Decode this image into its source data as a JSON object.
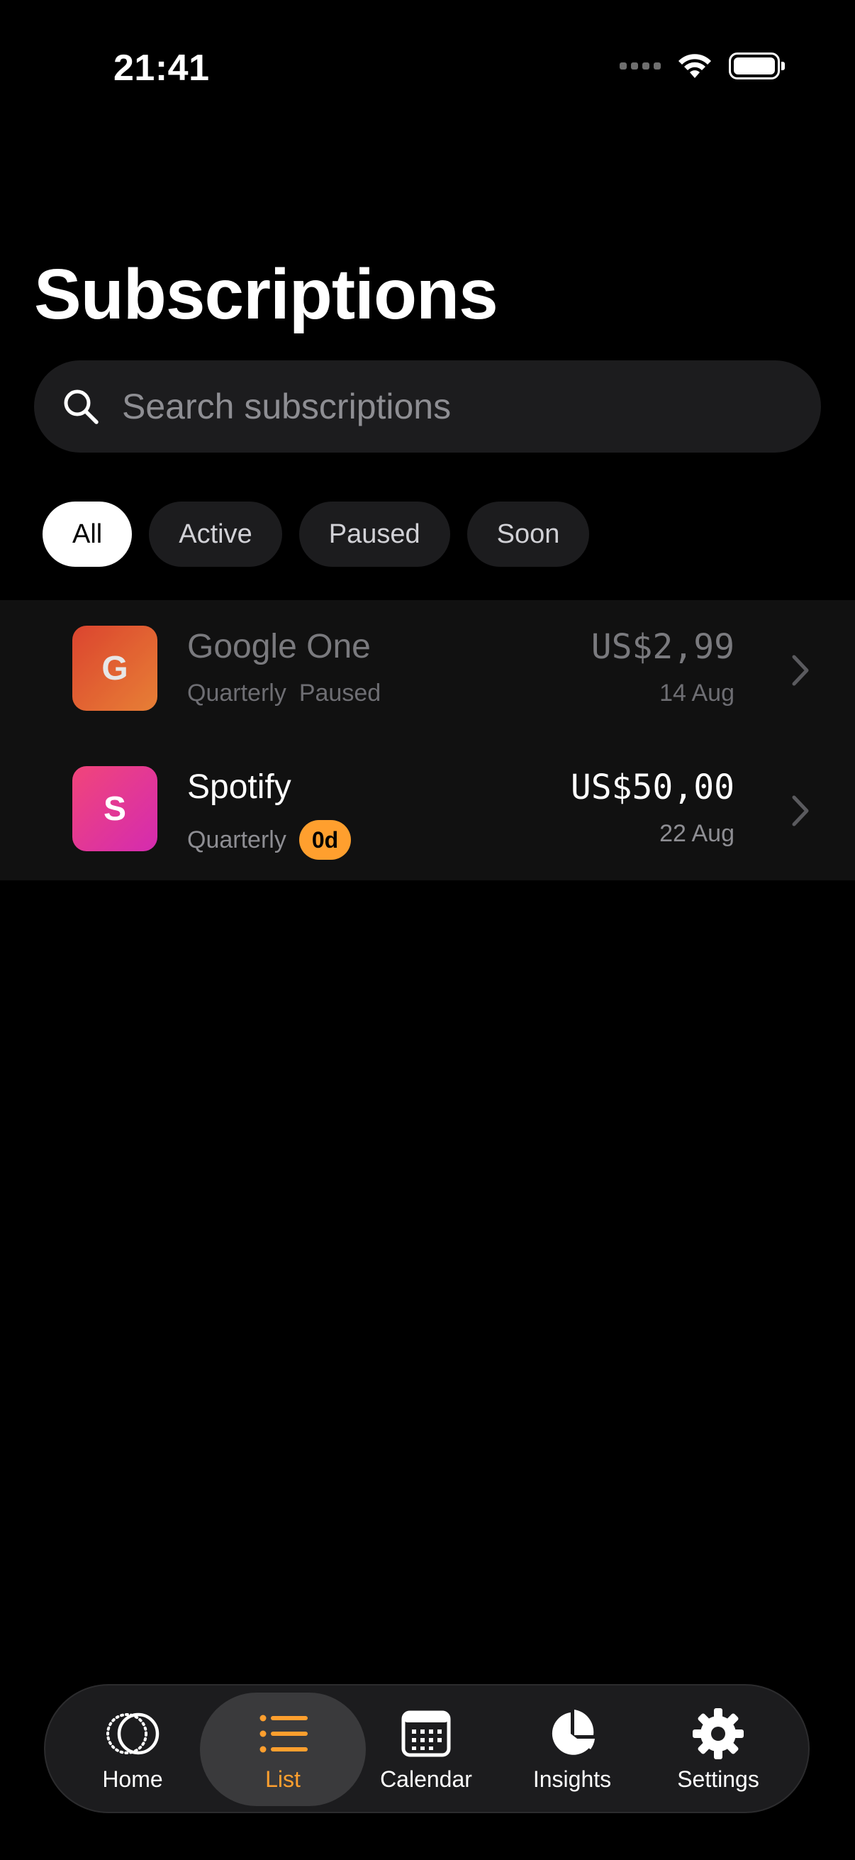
{
  "status_bar": {
    "time": "21:41"
  },
  "header": {
    "title": "Subscriptions"
  },
  "search": {
    "placeholder": "Search subscriptions"
  },
  "filters": [
    {
      "label": "All",
      "selected": true
    },
    {
      "label": "Active",
      "selected": false
    },
    {
      "label": "Paused",
      "selected": false
    },
    {
      "label": "Soon",
      "selected": false
    }
  ],
  "subscriptions": [
    {
      "initial": "G",
      "name": "Google One",
      "cycle": "Quarterly",
      "status": "Paused",
      "price": "US$2,99",
      "date": "14 Aug",
      "colors": [
        "#f24a32",
        "#ff8c3a"
      ]
    },
    {
      "initial": "S",
      "name": "Spotify",
      "cycle": "Quarterly",
      "badge": "0d",
      "price": "US$50,00",
      "date": "22 Aug",
      "colors": [
        "#f1457a",
        "#d42bb0"
      ]
    }
  ],
  "tabbar": {
    "items": [
      {
        "label": "Home",
        "icon": "home-orbit-icon"
      },
      {
        "label": "List",
        "icon": "list-icon",
        "selected": true
      },
      {
        "label": "Calendar",
        "icon": "calendar-icon"
      },
      {
        "label": "Insights",
        "icon": "pie-chart-icon"
      },
      {
        "label": "Settings",
        "icon": "gear-icon"
      }
    ]
  },
  "colors": {
    "accent": "#ff9f2e",
    "background": "#000000",
    "surface": "#1c1c1e"
  }
}
